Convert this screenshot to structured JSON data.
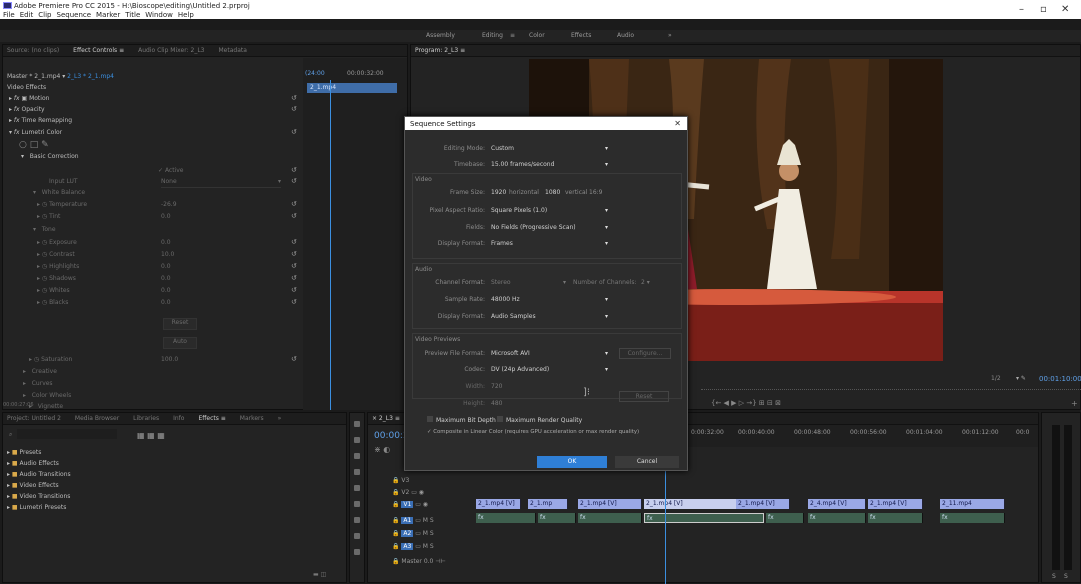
{
  "window": {
    "title": "Adobe Premiere Pro CC 2015 - H:\\Bioscope\\editing\\Untitled 2.prproj",
    "menu": [
      "File",
      "Edit",
      "Clip",
      "Sequence",
      "Marker",
      "Title",
      "Window",
      "Help"
    ],
    "controls": {
      "minimize": "–",
      "maximize": "▫",
      "close": "✕"
    }
  },
  "workspaces": {
    "items": [
      "Assembly",
      "Editing",
      "Color",
      "Effects",
      "Audio",
      "»"
    ],
    "active": "Editing",
    "active_menu": "≡"
  },
  "source_panel": {
    "tabs": [
      "Source: (no clips)",
      "Effect Controls ≡",
      "Audio Clip Mixer: 2_L3",
      "Metadata"
    ],
    "master_label": "Master * 2_1.mp4",
    "seq_label": "2_L3 * 2_1.mp4",
    "timecode_a": "(24:00",
    "timecode_b": "00:00:32:00",
    "clip_label": "2_1.mp4",
    "video_effects": "Video Effects",
    "motion": "Motion",
    "opacity": "Opacity",
    "time_remap": "Time Remapping",
    "lumetri": "Lumetri Color",
    "basic_correction": "Basic Correction",
    "active_label": "Active",
    "input_lut": "Input LUT",
    "input_lut_value": "None",
    "white_balance": "White Balance",
    "temperature": "Temperature",
    "temperature_val": "-26.9",
    "tint": "Tint",
    "tint_val": "0.0",
    "tone": "Tone",
    "exposure": "Exposure",
    "exposure_val": "0.0",
    "contrast": "Contrast",
    "contrast_val": "10.0",
    "highlights": "Highlights",
    "highlights_val": "0.0",
    "shadows": "Shadows",
    "shadows_val": "0.0",
    "whites": "Whites",
    "whites_val": "0.0",
    "blacks": "Blacks",
    "blacks_val": "0.0",
    "reset_btn": "Reset",
    "auto_btn": "Auto",
    "saturation": "Saturation",
    "saturation_val": "100.0",
    "creative": "Creative",
    "curves": "Curves",
    "color_wheels": "Color Wheels",
    "vignette": "Vignette",
    "timecode_bottom": "00:00:27:06"
  },
  "program_panel": {
    "tab": "Program: 2_L3 ≡",
    "scale": "1/2",
    "timecode": "00:01:10:00",
    "controls": "{←  ◀  ▶  ▷  →}  ⊞  ⊟  ⊠"
  },
  "project_panel": {
    "tabs": [
      "Project: Untitled 2",
      "Media Browser",
      "Libraries",
      "Info",
      "Effects ≡",
      "Markers",
      "»"
    ],
    "search_placeholder": "",
    "items": [
      "Presets",
      "Audio Effects",
      "Audio Transitions",
      "Video Effects",
      "Video Transitions",
      "Lumetri Presets"
    ]
  },
  "dialog": {
    "title": "Sequence Settings",
    "close": "✕",
    "editing_mode_label": "Editing Mode:",
    "editing_mode": "Custom",
    "timebase_label": "Timebase:",
    "timebase": "15.00 frames/second",
    "video_section": "Video",
    "frame_size_label": "Frame Size:",
    "frame_w": "1920",
    "horizontal": "horizontal",
    "frame_h": "1080",
    "vertical": "vertical",
    "aspect": "16:9",
    "par_label": "Pixel Aspect Ratio:",
    "par": "Square Pixels (1.0)",
    "fields_label": "Fields:",
    "fields": "No Fields (Progressive Scan)",
    "display_format_label": "Display Format:",
    "display_format": "Frames",
    "audio_section": "Audio",
    "channel_format_label": "Channel Format:",
    "channel_format": "Stereo",
    "num_channels_label": "Number of Channels:",
    "num_channels": "2",
    "sample_rate_label": "Sample Rate:",
    "sample_rate": "48000 Hz",
    "audio_display_label": "Display Format:",
    "audio_display": "Audio Samples",
    "preview_section": "Video Previews",
    "preview_format_label": "Preview File Format:",
    "preview_format": "Microsoft AVI",
    "configure_btn": "Configure...",
    "codec_label": "Codec:",
    "codec": "DV (24p Advanced)",
    "width_label": "Width:",
    "width": "720",
    "height_label": "Height:",
    "height": "480",
    "reset_btn": "Reset",
    "max_bit_depth": "Maximum Bit Depth",
    "max_render": "Maximum Render Quality",
    "composite_linear": "Composite in Linear Color (requires GPU acceleration or max render quality)",
    "ok_btn": "OK",
    "cancel_btn": "Cancel"
  },
  "timeline": {
    "tab": "× 2_L3 ≡",
    "timecode": "00:00:2",
    "ruler": [
      "0:00:32:00",
      "00:00:40:00",
      "00:00:48:00",
      "00:00:56:00",
      "00:01:04:00",
      "00:01:12:00",
      "00:0"
    ],
    "tracks": [
      "V3",
      "V2",
      "V1",
      "A1",
      "A2",
      "A3"
    ],
    "master_label": "Master",
    "master_val": "0.0",
    "video_clips": [
      "2_1.mp4 [V]",
      "2_1.mp",
      "2_1.mp4 [V]",
      "2_1.mp4 [V]",
      "2_1.mp4 [V]",
      "2_4.mp4 [V]",
      "2_1.mp4 [V]",
      "2_11.mp4"
    ],
    "audio_clip": "fx"
  },
  "meter_labels": [
    "S",
    "S"
  ]
}
